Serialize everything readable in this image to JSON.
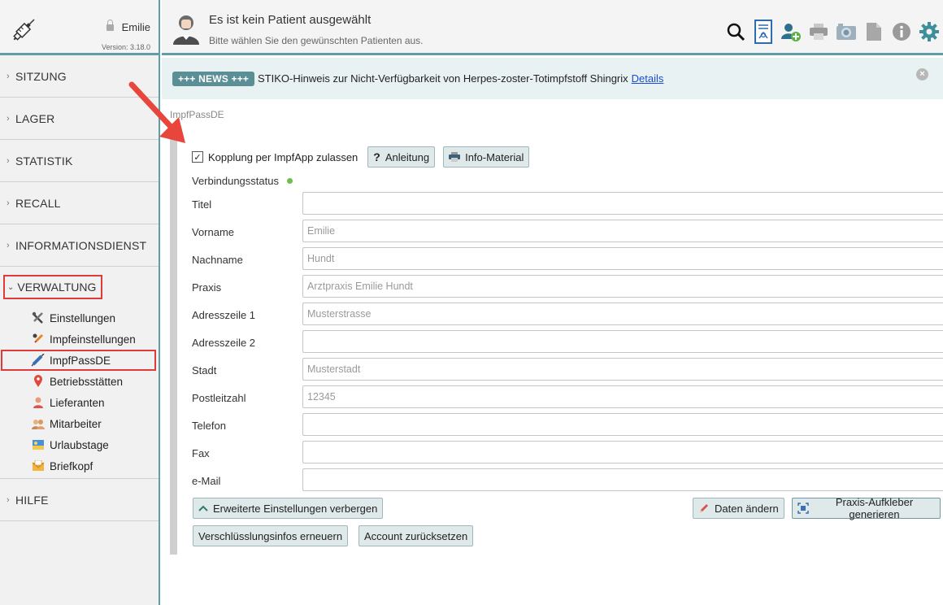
{
  "sidebar": {
    "user": "Emilie",
    "version": "Version: 3.18.0",
    "sections_top": [
      {
        "label": "SITZUNG"
      },
      {
        "label": "LAGER"
      },
      {
        "label": "STATISTIK"
      },
      {
        "label": "RECALL"
      },
      {
        "label": "INFORMATIONSDIENST"
      }
    ],
    "verwaltung": {
      "label": "VERWALTUNG",
      "items": [
        {
          "label": "Einstellungen",
          "icon": "tools-icon"
        },
        {
          "label": "Impfeinstellungen",
          "icon": "syringe-settings-icon"
        },
        {
          "label": "ImpfPassDE",
          "icon": "syringe-icon"
        },
        {
          "label": "Betriebsstätten",
          "icon": "location-pin-icon"
        },
        {
          "label": "Lieferanten",
          "icon": "supplier-icon"
        },
        {
          "label": "Mitarbeiter",
          "icon": "staff-icon"
        },
        {
          "label": "Urlaubstage",
          "icon": "vacation-icon"
        },
        {
          "label": "Briefkopf",
          "icon": "envelope-icon"
        }
      ]
    },
    "hilfe": {
      "label": "HILFE"
    }
  },
  "topbar": {
    "title": "Es ist kein Patient ausgewählt",
    "subtitle": "Bitte wählen Sie den gewünschten Patienten aus."
  },
  "news": {
    "badge": "+++ NEWS +++",
    "text": "STIKO-Hinweis zur Nicht-Verfügbarkeit von Herpes-zoster-Totimpfstoff Shingrix",
    "link": "Details"
  },
  "page": {
    "label": "ImpfPassDE",
    "checkbox_label": "Kopplung per ImpfApp zulassen",
    "anleitung": "Anleitung",
    "info_material": "Info-Material",
    "status_label": "Verbindungsstatus",
    "fields": [
      {
        "label": "Titel",
        "value": "",
        "placeholder": ""
      },
      {
        "label": "Vorname",
        "value": "",
        "placeholder": "Emilie"
      },
      {
        "label": "Nachname",
        "value": "",
        "placeholder": "Hundt"
      },
      {
        "label": "Praxis",
        "value": "",
        "placeholder": "Arztpraxis Emilie Hundt"
      },
      {
        "label": "Adresszeile 1",
        "value": "",
        "placeholder": "Musterstrasse"
      },
      {
        "label": "Adresszeile 2",
        "value": "",
        "placeholder": ""
      },
      {
        "label": "Stadt",
        "value": "",
        "placeholder": "Musterstadt"
      },
      {
        "label": "Postleitzahl",
        "value": "",
        "placeholder": "12345"
      },
      {
        "label": "Telefon",
        "value": "",
        "placeholder": ""
      },
      {
        "label": "Fax",
        "value": "",
        "placeholder": ""
      },
      {
        "label": "e-Mail",
        "value": "",
        "placeholder": ""
      }
    ],
    "btn_advanced": "Erweiterte Einstellungen verbergen",
    "btn_edit": "Daten ändern",
    "btn_sticker": "Praxis-Aufkleber generieren",
    "btn_renew": "Verschlüsslungsinfos erneuern",
    "btn_reset": "Account zurücksetzen"
  },
  "colors": {
    "accent": "#5f9ea8",
    "highlight_red": "#e03b3b",
    "arrow_red": "#e8453c",
    "status_green": "#6cc04a",
    "gear_teal": "#3f8f9a"
  }
}
